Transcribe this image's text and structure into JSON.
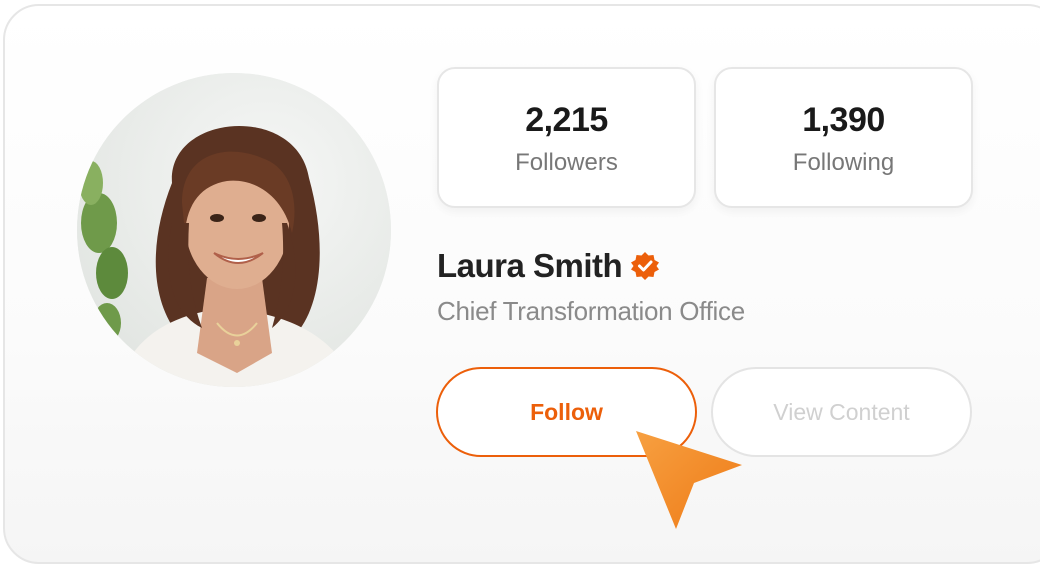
{
  "profile": {
    "name": "Laura Smith",
    "title": "Chief Transformation Office",
    "verified_icon": "verified-badge-icon",
    "avatar_icon": "profile-photo"
  },
  "stats": {
    "followers": {
      "value": "2,215",
      "label": "Followers"
    },
    "following": {
      "value": "1,390",
      "label": "Following"
    }
  },
  "actions": {
    "follow_label": "Follow",
    "view_content_label": "View Content"
  },
  "colors": {
    "accent": "#ec5f0a",
    "text_primary": "#222222",
    "text_secondary": "#8a8a8a",
    "border": "#e6e6e6",
    "disabled_text": "#d0d0d0"
  }
}
